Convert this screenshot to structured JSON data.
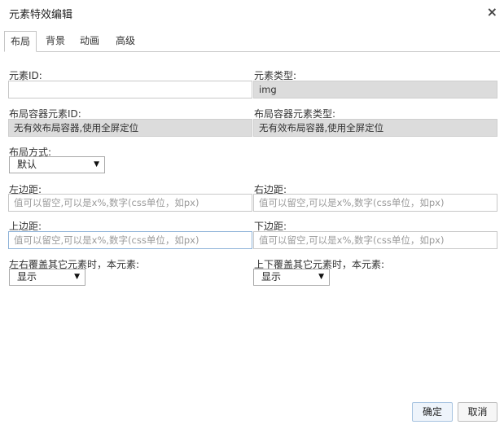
{
  "dialog": {
    "title": "元素特效编辑",
    "close_glyph": "×"
  },
  "tabs": [
    {
      "label": "布局",
      "active": true
    },
    {
      "label": "背景",
      "active": false
    },
    {
      "label": "动画",
      "active": false
    },
    {
      "label": "高级",
      "active": false
    }
  ],
  "form": {
    "element_id": {
      "label": "元素ID:",
      "value": ""
    },
    "element_type": {
      "label": "元素类型:",
      "value": "img"
    },
    "container_id": {
      "label": "布局容器元素ID:",
      "value": "无有效布局容器,使用全屏定位"
    },
    "container_type": {
      "label": "布局容器元素类型:",
      "value": "无有效布局容器,使用全屏定位"
    },
    "layout_mode": {
      "label": "布局方式:",
      "selected": "默认"
    },
    "margin_left": {
      "label": "左边距:",
      "placeholder": "值可以留空,可以是x%,数字(css单位，如px)"
    },
    "margin_right": {
      "label": "右边距:",
      "placeholder": "值可以留空,可以是x%,数字(css单位，如px)"
    },
    "margin_top": {
      "label": "上边距:",
      "placeholder": "值可以留空,可以是x%,数字(css单位，如px)"
    },
    "margin_bottom": {
      "label": "下边距:",
      "placeholder": "值可以留空,可以是x%,数字(css单位，如px)"
    },
    "h_overlap": {
      "label": "左右覆盖其它元素时，本元素:",
      "selected": "显示"
    },
    "v_overlap": {
      "label": "上下覆盖其它元素时，本元素:",
      "selected": "显示"
    }
  },
  "buttons": {
    "ok": "确定",
    "cancel": "取消"
  },
  "icons": {
    "dropdown": "▼"
  }
}
